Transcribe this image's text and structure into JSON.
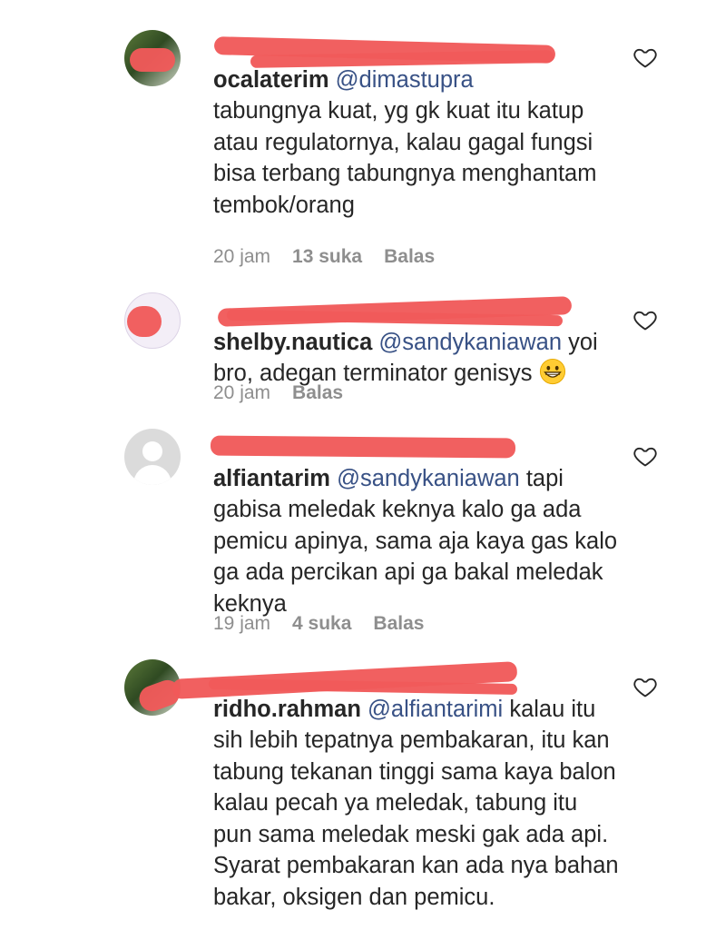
{
  "comments": [
    {
      "username": "ocalaterim",
      "mention": "@dimastupra",
      "text": "tabungnya kuat, yg gk kuat itu katup atau regulatornya, kalau gagal fungsi bisa terbang tabungnya menghantam tembok/orang",
      "time": "20 jam",
      "likes": "13 suka",
      "reply": "Balas"
    },
    {
      "username": "shelby.nautica",
      "mention": "@sandykaniawan",
      "text": "yoi bro, adegan terminator genisys",
      "emoji": "grinning-face",
      "time": "20 jam",
      "reply": "Balas"
    },
    {
      "username": "alfiantarim",
      "mention": "@sandykaniawan",
      "text": "tapi gabisa meledak keknya kalo ga ada pemicu apinya, sama aja kaya gas kalo ga ada percikan api ga bakal meledak keknya",
      "time": "19 jam",
      "likes": "4 suka",
      "reply": "Balas"
    },
    {
      "username": "ridho.rahman",
      "mention": "@alfiantarimi",
      "text": "kalau itu sih lebih tepatnya pembakaran, itu kan tabung tekanan tinggi sama kaya balon kalau pecah ya meledak, tabung itu pun sama meledak meski gak ada api. Syarat pembakaran kan ada nya bahan bakar, oksigen dan pemicu."
    }
  ],
  "icons": {
    "like": "heart-outline-icon"
  },
  "colors": {
    "redaction": "#f05a5a",
    "text": "#262626",
    "meta": "#8e8e8e",
    "mention": "#385185"
  }
}
